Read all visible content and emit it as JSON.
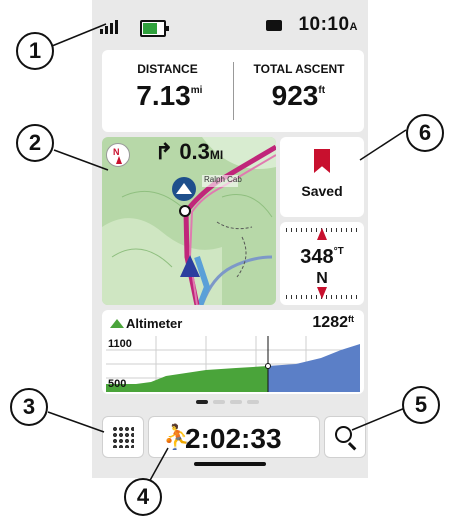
{
  "status_bar": {
    "time": "10:10",
    "time_suffix": "A",
    "battery_level": 0.8,
    "icons": [
      "signal-icon",
      "battery-icon",
      "message-icon"
    ]
  },
  "fields": [
    {
      "label": "DISTANCE",
      "value": "7.13",
      "unit": "mi"
    },
    {
      "label": "TOTAL ASCENT",
      "value": "923",
      "unit": "ft"
    }
  ],
  "map": {
    "next_turn": "0.3",
    "next_turn_unit": "MI",
    "compass_marker": "N",
    "label": "Ralph Cab"
  },
  "saved": {
    "label": "Saved",
    "icon": "bookmark-icon"
  },
  "compass": {
    "heading": "348",
    "heading_unit": "°T",
    "direction": "N"
  },
  "altimeter": {
    "title": "Altimeter",
    "value": "1282",
    "unit": "ft",
    "y_ticks": [
      "1100",
      "500"
    ]
  },
  "page_indicator": {
    "count": 4,
    "active": 0
  },
  "bottom": {
    "apps_icon": "grid-icon",
    "activity_icon": "hiking-icon",
    "timer": "2:02:33",
    "search_icon": "search-icon"
  },
  "callouts": [
    "1",
    "2",
    "3",
    "4",
    "5",
    "6"
  ],
  "colors": {
    "accent_red": "#c8102e",
    "map_green": "#b7d8a8",
    "route": "#c0267a",
    "elevation_green": "#4aa43a",
    "elevation_blue": "#5b7fc7"
  }
}
